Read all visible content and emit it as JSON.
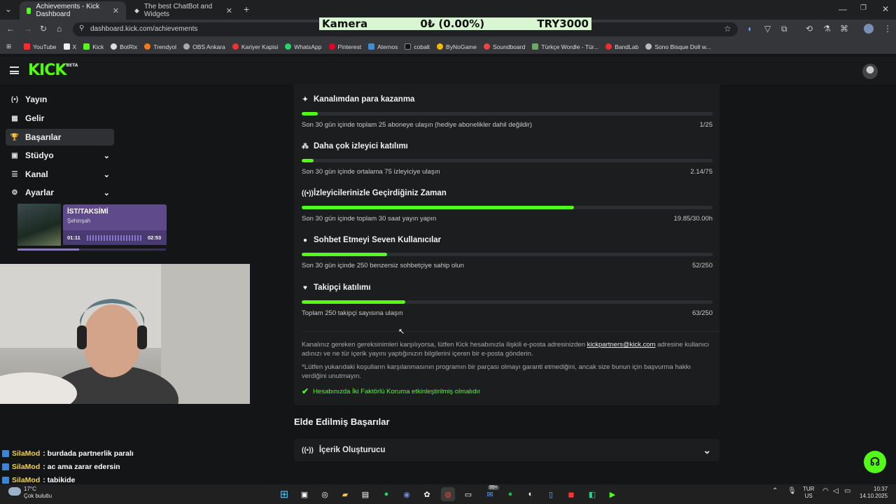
{
  "browser": {
    "tabs": [
      {
        "title": "Achievements - Kick Dashboard",
        "active": true
      },
      {
        "title": "The best ChatBot and Widgets",
        "active": false
      }
    ],
    "url": "dashboard.kick.com/achievements",
    "bookmarks": [
      "YouTube",
      "X",
      "Kick",
      "BotRix",
      "Trendyol",
      "OBS Ankara",
      "Kariyer Kapisi",
      "WhatsApp",
      "Pinterest",
      "Aternos",
      "cobalt",
      "ByNoGame",
      "Soundboard",
      "Türkçe Wordle - Tür...",
      "BandLab",
      "Sono Bisque Doll w..."
    ]
  },
  "ticker": {
    "label": "Kamera",
    "value": "0₺ (0.00%)",
    "goal": "TRY3000"
  },
  "site": {
    "logo": "KICK",
    "logo_badge": "BETA"
  },
  "sidebar": {
    "items": [
      {
        "label": "Yayın",
        "icon": "(•)"
      },
      {
        "label": "Gelir",
        "icon": "▦"
      },
      {
        "label": "Başarılar",
        "icon": "🏆"
      },
      {
        "label": "Stüdyo",
        "icon": "▣"
      },
      {
        "label": "Kanal",
        "icon": "☰"
      },
      {
        "label": "Ayarlar",
        "icon": "⚙"
      }
    ]
  },
  "music": {
    "title": "İST/TAKSİMİ",
    "artist": "Şehinşah",
    "elapsed": "01:11",
    "duration": "02:53",
    "progress": 0.41
  },
  "chat": [
    {
      "user": "SilaMod",
      "text": ": burdada partnerlik paralı"
    },
    {
      "user": "SilaMod",
      "text": ": ac ama zarar edersin"
    },
    {
      "user": "SilaMod",
      "text": ": tabikide"
    }
  ],
  "achievements": [
    {
      "icon": "✦",
      "title": "Kanalımdan para kazanma",
      "desc": "Son 30 gün içinde toplam 25 aboneye ulaşın (hediye abonelikler dahil değildir)",
      "value": "1/25",
      "progress": 0.04
    },
    {
      "icon": "⁂",
      "title": "Daha çok izleyici katılımı",
      "desc": "Son 30 gün içinde ortalama 75 izleyiciye ulaşın",
      "value": "2.14/75",
      "progress": 0.029
    },
    {
      "icon": "((•))",
      "title": "İzleyicilerinizle Geçirdiğiniz Zaman",
      "desc": "Son 30 gün içinde toplam 30 saat yayın yapın",
      "value": "19.85/30.00h",
      "progress": 0.662
    },
    {
      "icon": "●",
      "title": "Sohbet Etmeyi Seven Kullanıcılar",
      "desc": "Son 30 gün içinde 250 benzersiz sohbetçiye sahip olun",
      "value": "52/250",
      "progress": 0.208
    },
    {
      "icon": "♥",
      "title": "Takipçi katılımı",
      "desc": "Toplam 250 takipçi sayısına ulaşın",
      "value": "63/250",
      "progress": 0.252
    }
  ],
  "notes": {
    "line1_pre": "Kanalınız gereken gereksinimleri karşılıyorsa, lütfen Kick hesabınızla ilişkili e-posta adresinizden",
    "email": "kickpartners@kick.com",
    "line1_post": "adresine kullanıcı adınızı ve ne tür içerik yayını yaptığınızın bilgilerini içeren bir e-posta gönderin.",
    "line2": "*Lütfen yukarıdaki koşulların karşılanmasının programın bir parçası olmayı garanti etmediğini, ancak size bunun için başvurma hakkı verdiğini unutmayın.",
    "twofa": "Hesabınızda İki Faktörlü Koruma etkinleştirilmiş olmalıdır"
  },
  "earned": {
    "heading": "Elde Edilmiş Başarılar",
    "item": "İçerik Oluşturucu"
  },
  "taskbar": {
    "weather_temp": "17°C",
    "weather_desc": "Çok bulutlu",
    "lang1": "TUR",
    "lang2": "US",
    "time": "10:37",
    "date": "14.10.2025",
    "badge": "99+"
  },
  "colors": {
    "accent": "#53fc18",
    "music_bg": "#5f4b8b"
  }
}
